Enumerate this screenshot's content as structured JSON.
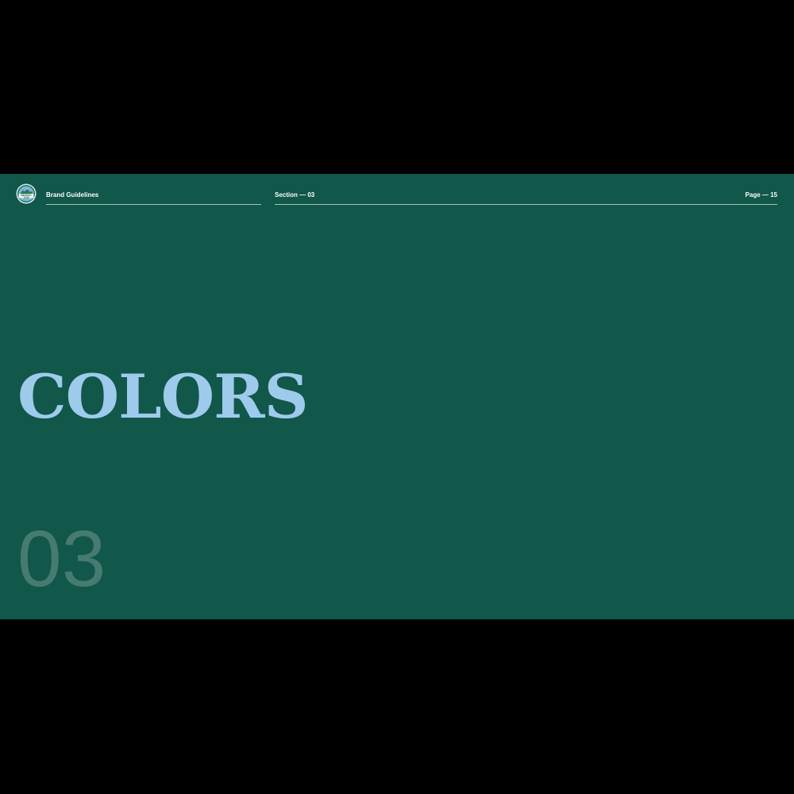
{
  "header": {
    "logo": {
      "icon": "rising-tide-mountain-badge",
      "text_line1": "RISING",
      "text_line2": "TIDE"
    },
    "brand_label": "Brand Guidelines",
    "section_label": "Section — 03",
    "page_label": "Page — 15"
  },
  "main": {
    "title": "COLORS",
    "section_number": "03"
  },
  "colors": {
    "background": "#11574a",
    "title": "#9ecbec",
    "header_text": "#ffffff",
    "rule": "#9fc8c0",
    "frame": "#000000"
  }
}
